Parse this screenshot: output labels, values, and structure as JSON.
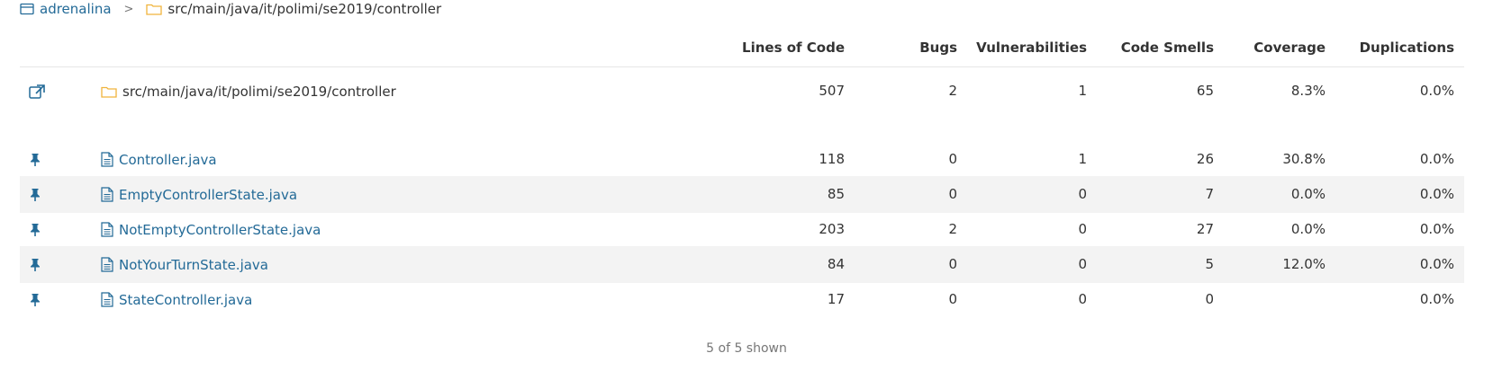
{
  "breadcrumb": {
    "project": "adrenalina",
    "separator": ">",
    "directory": "src/main/java/it/polimi/se2019/controller"
  },
  "columns": {
    "lines_of_code": "Lines of Code",
    "bugs": "Bugs",
    "vulnerabilities": "Vulnerabilities",
    "code_smells": "Code Smells",
    "coverage": "Coverage",
    "duplications": "Duplications"
  },
  "summary": {
    "name": "src/main/java/it/polimi/se2019/controller",
    "lines_of_code": "507",
    "bugs": "2",
    "vulnerabilities": "1",
    "code_smells": "65",
    "coverage": "8.3%",
    "duplications": "0.0%"
  },
  "files": [
    {
      "name": "Controller.java",
      "lines_of_code": "118",
      "bugs": "0",
      "vulnerabilities": "1",
      "code_smells": "26",
      "coverage": "30.8%",
      "duplications": "0.0%"
    },
    {
      "name": "EmptyControllerState.java",
      "lines_of_code": "85",
      "bugs": "0",
      "vulnerabilities": "0",
      "code_smells": "7",
      "coverage": "0.0%",
      "duplications": "0.0%"
    },
    {
      "name": "NotEmptyControllerState.java",
      "lines_of_code": "203",
      "bugs": "2",
      "vulnerabilities": "0",
      "code_smells": "27",
      "coverage": "0.0%",
      "duplications": "0.0%"
    },
    {
      "name": "NotYourTurnState.java",
      "lines_of_code": "84",
      "bugs": "0",
      "vulnerabilities": "0",
      "code_smells": "5",
      "coverage": "12.0%",
      "duplications": "0.0%"
    },
    {
      "name": "StateController.java",
      "lines_of_code": "17",
      "bugs": "0",
      "vulnerabilities": "0",
      "code_smells": "0",
      "coverage": "",
      "duplications": "0.0%"
    }
  ],
  "footer": "5 of 5 shown",
  "icons": {
    "project": "project-icon",
    "folder": "folder-icon",
    "open_component": "external-link-icon",
    "pin": "pin-icon",
    "file": "file-icon"
  },
  "colors": {
    "link": "#236a97",
    "folder": "#f0b43c",
    "alt_row": "#f3f3f3"
  }
}
